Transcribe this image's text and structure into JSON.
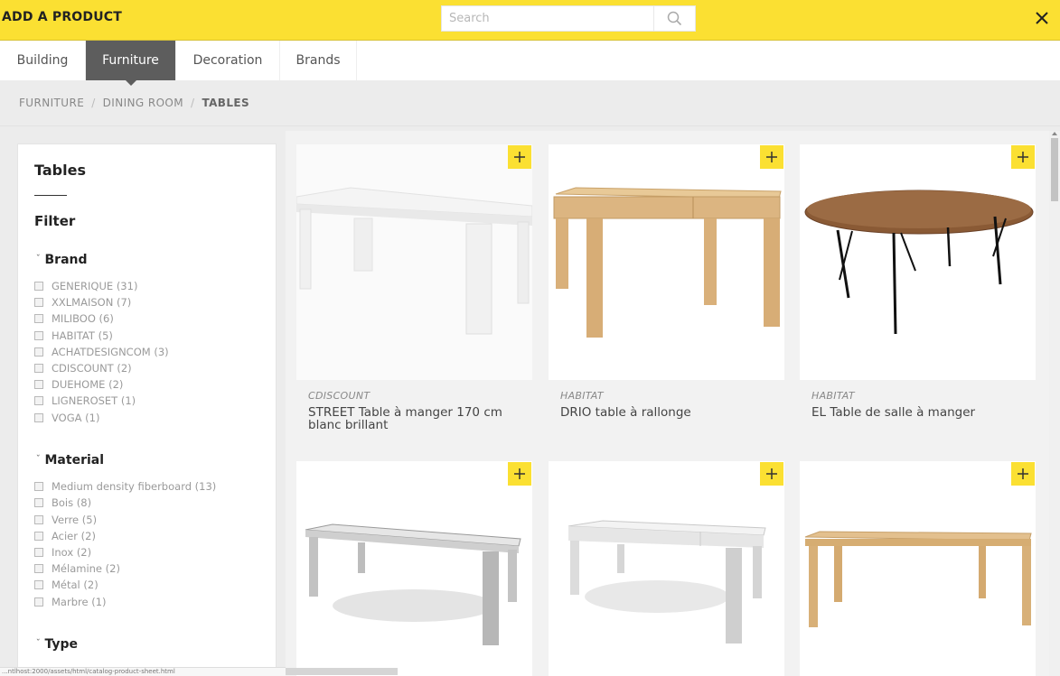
{
  "header": {
    "title": "ADD A PRODUCT",
    "search_placeholder": "Search",
    "search_icon": "search-icon",
    "close_icon": "close-icon"
  },
  "tabs": [
    {
      "label": "Building",
      "active": false
    },
    {
      "label": "Furniture",
      "active": true
    },
    {
      "label": "Decoration",
      "active": false
    },
    {
      "label": "Brands",
      "active": false
    }
  ],
  "breadcrumb": [
    "FURNITURE",
    "DINING ROOM",
    "TABLES"
  ],
  "sidebar": {
    "title": "Tables",
    "filter_label": "Filter",
    "groups": [
      {
        "title": "Brand",
        "options": [
          "GENERIQUE (31)",
          "XXLMAISON (7)",
          "MILIBOO (6)",
          "HABITAT (5)",
          "ACHATDESIGNCOM (3)",
          "CDISCOUNT (2)",
          "DUEHOME (2)",
          "LIGNEROSET (1)",
          "VOGA (1)"
        ]
      },
      {
        "title": "Material",
        "options": [
          "Medium density fiberboard (13)",
          "Bois (8)",
          "Verre (5)",
          "Acier (2)",
          "Inox (2)",
          "Mélamine (2)",
          "Métal (2)",
          "Marbre (1)"
        ]
      },
      {
        "title": "Type",
        "options": []
      }
    ]
  },
  "products": [
    {
      "brand": "CDISCOUNT",
      "name": "STREET Table à manger 170 cm blanc brillant",
      "image": "white-lacquer-table"
    },
    {
      "brand": "HABITAT",
      "name": "DRIO table à rallonge",
      "image": "oak-extending-table"
    },
    {
      "brand": "HABITAT",
      "name": "EL Table de salle à manger",
      "image": "walnut-oval-table"
    },
    {
      "brand": "",
      "name": "",
      "image": "grey-steel-table"
    },
    {
      "brand": "",
      "name": "",
      "image": "white-extending-table"
    },
    {
      "brand": "",
      "name": "",
      "image": "light-oak-table"
    }
  ],
  "add_icon": "plus-icon",
  "status_text": "...ntlhost:2000/assets/html/catalog-product-sheet.html",
  "colors": {
    "accent": "#fbe032",
    "active_tab": "#5d5d5d",
    "background": "#f2f2f2"
  }
}
